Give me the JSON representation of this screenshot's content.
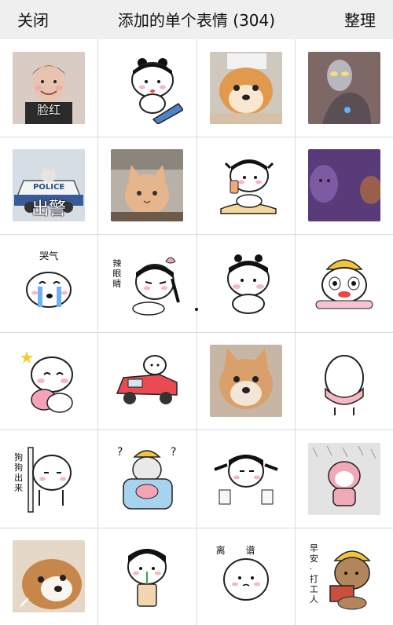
{
  "header": {
    "close_label": "关闭",
    "title": "添加的单个表情 (304)",
    "organize_label": "整理"
  },
  "grid": {
    "captions": {
      "blush": "脸红",
      "police_big": "出警",
      "police_sign": "POLICE",
      "cry": "哭气",
      "spicy": "辣眼睛",
      "dog": "狗狗出来",
      "leave": "离谱",
      "morning": "早安·打工人"
    }
  },
  "colors": {
    "header_bg": "#efefef",
    "grid_line": "#dadada",
    "cheek": "#f6b8c4"
  }
}
